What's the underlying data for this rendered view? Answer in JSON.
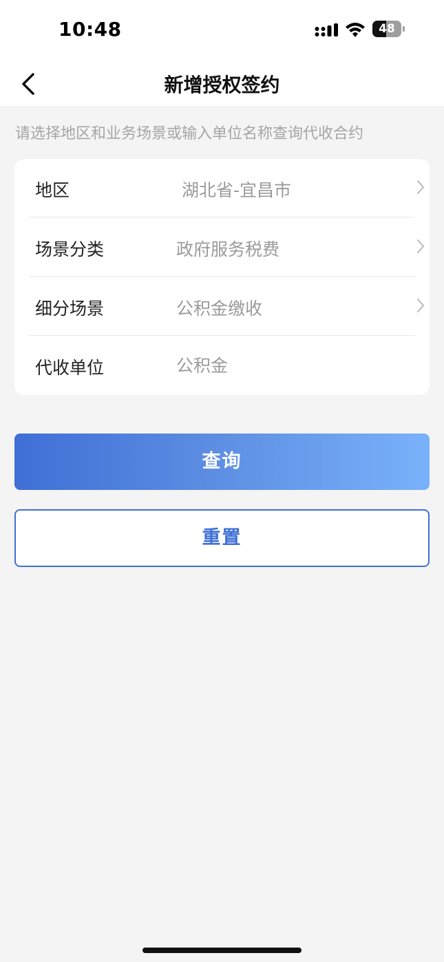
{
  "status_bar": {
    "time": "10:48",
    "battery_percent": "48",
    "battery_level": 0.48
  },
  "nav": {
    "title": "新增授权签约"
  },
  "hint": "请选择地区和业务场景或输入单位名称查询代收合约",
  "form": {
    "region": {
      "label": "地区",
      "value": "湖北省-宜昌市"
    },
    "scene_category": {
      "label": "场景分类",
      "value": "政府服务税费"
    },
    "sub_scene": {
      "label": "细分场景",
      "value": "公积金缴收"
    },
    "collecting_unit": {
      "label": "代收单位",
      "value": "公积金"
    }
  },
  "buttons": {
    "query": "查询",
    "reset": "重置"
  },
  "colors": {
    "accent": "#3f6fd6",
    "gradient_end": "#79b1fa",
    "background": "#f4f4f4"
  }
}
